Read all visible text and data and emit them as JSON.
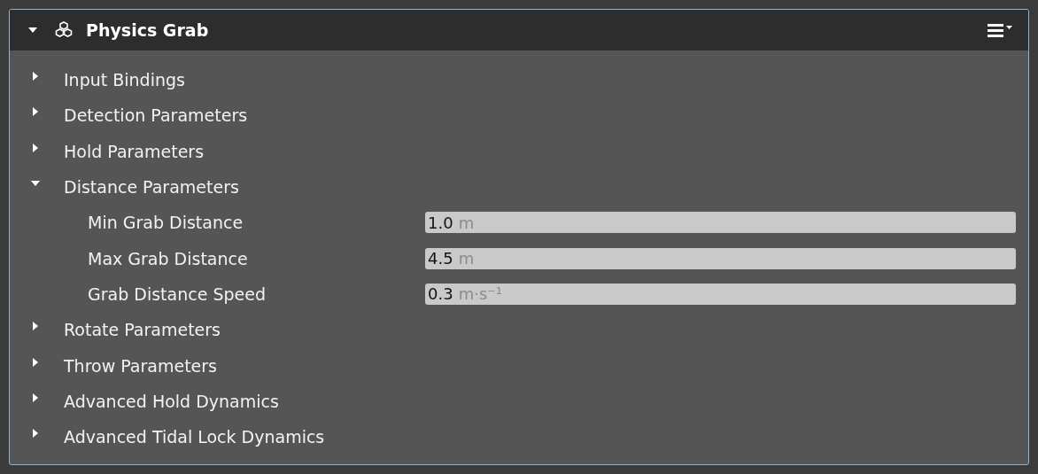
{
  "panel": {
    "title": "Physics Grab",
    "expanded": true
  },
  "sections": [
    {
      "label": "Input Bindings",
      "expanded": false
    },
    {
      "label": "Detection Parameters",
      "expanded": false
    },
    {
      "label": "Hold Parameters",
      "expanded": false
    },
    {
      "label": "Distance Parameters",
      "expanded": true,
      "children": [
        {
          "label": "Min Grab Distance",
          "value": "1.0",
          "unit": "m"
        },
        {
          "label": "Max Grab Distance",
          "value": "4.5",
          "unit": "m"
        },
        {
          "label": "Grab Distance Speed",
          "value": "0.3",
          "unit": "m·s⁻¹"
        }
      ]
    },
    {
      "label": "Rotate Parameters",
      "expanded": false
    },
    {
      "label": "Throw Parameters",
      "expanded": false
    },
    {
      "label": "Advanced Hold Dynamics",
      "expanded": false
    },
    {
      "label": "Advanced Tidal Lock Dynamics",
      "expanded": false
    }
  ]
}
